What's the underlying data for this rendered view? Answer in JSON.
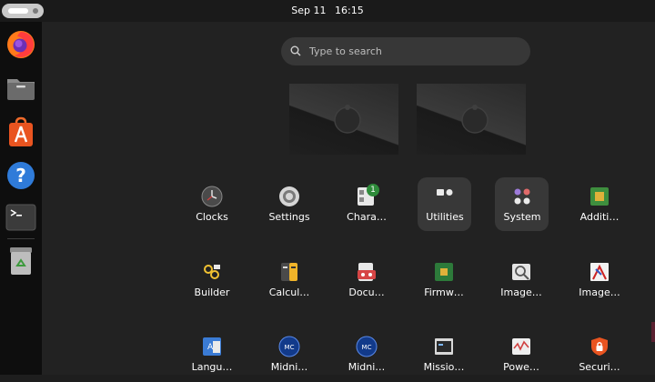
{
  "topbar": {
    "date": "Sep 11",
    "time": "16:15"
  },
  "dock": [
    {
      "name": "firefox"
    },
    {
      "name": "files"
    },
    {
      "name": "app-center"
    },
    {
      "name": "help"
    },
    {
      "name": "terminal"
    },
    {
      "name": "trash"
    }
  ],
  "search": {
    "placeholder": "Type to search"
  },
  "apps": [
    {
      "label": "Clocks",
      "icon": "clock-icon"
    },
    {
      "label": "Settings",
      "icon": "gear-icon"
    },
    {
      "label": "Chara…",
      "icon": "character-map-icon",
      "badge": "1"
    },
    {
      "label": "Utilities",
      "icon": "folder-icon"
    },
    {
      "label": "System",
      "icon": "folder-icon"
    },
    {
      "label": "Additi…",
      "icon": "chip-icon"
    },
    {
      "label": "Builder",
      "icon": "builder-icon"
    },
    {
      "label": "Calcul…",
      "icon": "calculator-icon"
    },
    {
      "label": "Docu…",
      "icon": "document-scanner-icon"
    },
    {
      "label": "Firmw…",
      "icon": "firmware-chip-icon"
    },
    {
      "label": "Image…",
      "icon": "image-viewer-icon"
    },
    {
      "label": "Image…",
      "icon": "image-editor-icon"
    },
    {
      "label": "Langu…",
      "icon": "language-icon"
    },
    {
      "label": "Midni…",
      "icon": "midnight-commander-icon"
    },
    {
      "label": "Midni…",
      "icon": "midnight-commander-icon"
    },
    {
      "label": "Missio…",
      "icon": "mission-center-icon"
    },
    {
      "label": "Powe…",
      "icon": "power-statistics-icon"
    },
    {
      "label": "Securi…",
      "icon": "security-shield-icon"
    }
  ]
}
